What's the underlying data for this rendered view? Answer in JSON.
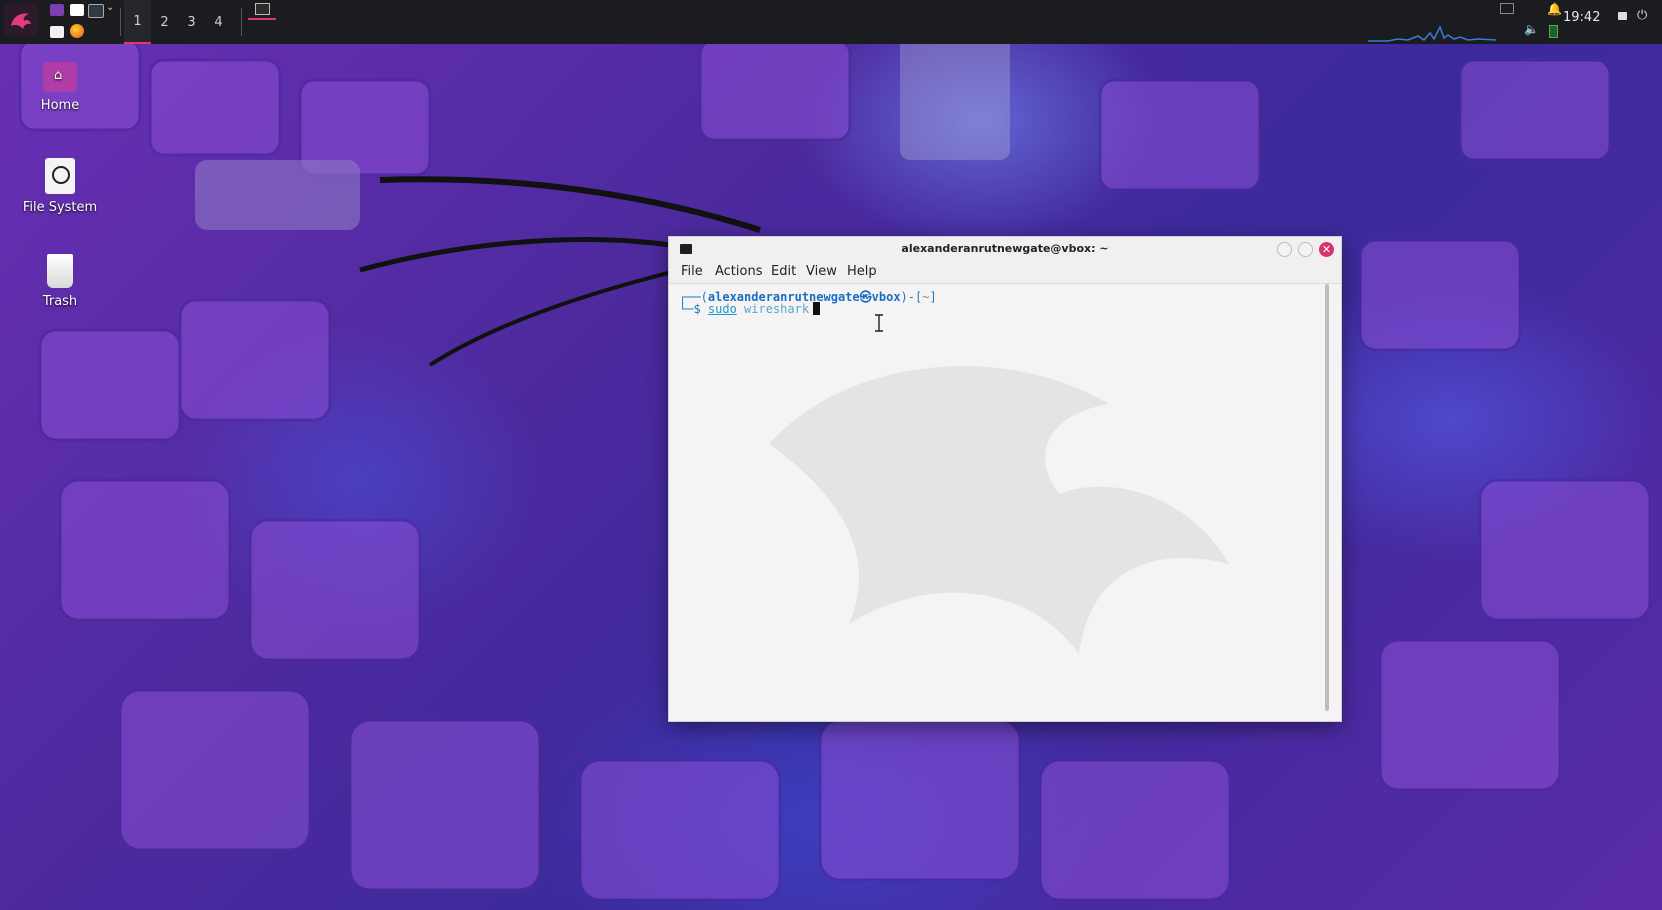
{
  "panel": {
    "workspaces": [
      "1",
      "2",
      "3",
      "4"
    ],
    "active_workspace": "1",
    "clock": "19:42"
  },
  "desktop": {
    "icons": [
      {
        "label": "Home",
        "icon": "home-folder-icon"
      },
      {
        "label": "File System",
        "icon": "drive-icon"
      },
      {
        "label": "Trash",
        "icon": "trash-icon"
      }
    ]
  },
  "terminal": {
    "title": "alexanderanrutnewgate@vbox: ~",
    "menu": [
      "File",
      "Actions",
      "View",
      "Help"
    ],
    "menu_edit": "Edit",
    "prompt": {
      "open": "┌──(",
      "user": "alexanderanrutnewgate",
      "at": "㉿",
      "host": "vbox",
      "mid": ")-[",
      "dir": "~",
      "close": "]",
      "line2_prefix": "└─$ "
    },
    "command_sudo": "sudo",
    "command_rest": " wireshark"
  },
  "colors": {
    "accent": "#e0357a",
    "close_button": "#d8336b",
    "panel_bg": "#1b1c20",
    "prompt_blue": "#1a6fc2"
  }
}
